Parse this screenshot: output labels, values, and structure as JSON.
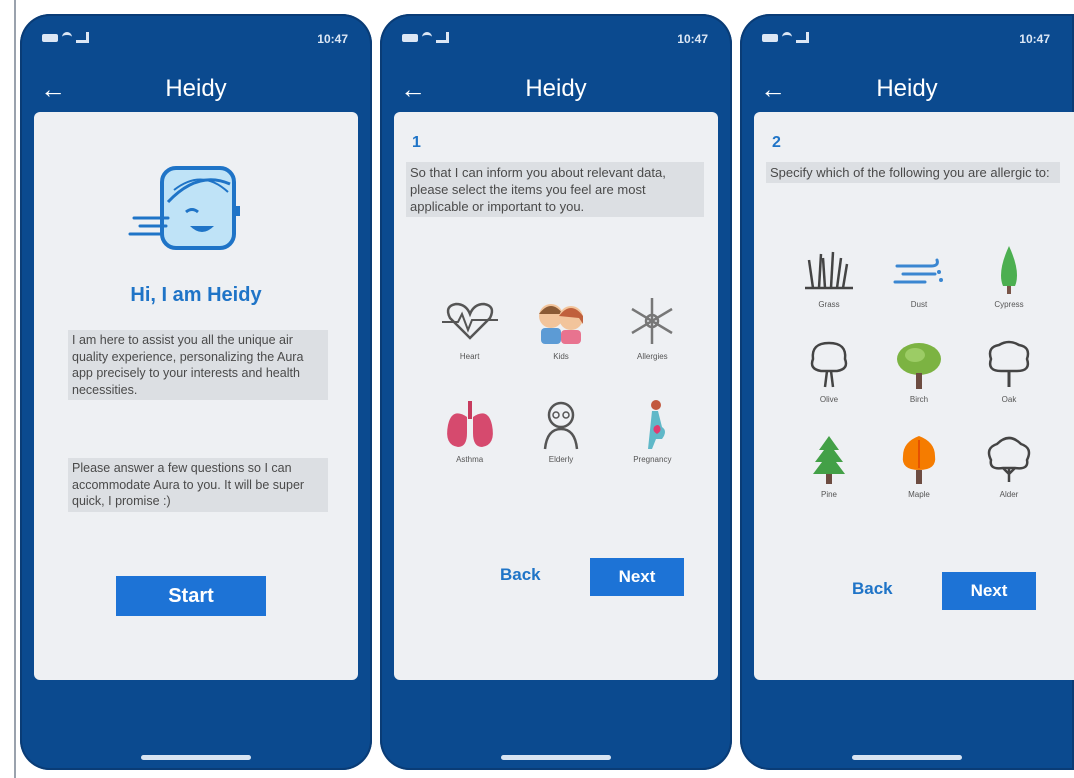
{
  "status": {
    "time": "10:47"
  },
  "screen1": {
    "title": "Heidy",
    "greeting": "Hi, I am Heidy",
    "intro_p1": "I am here to assist you all the unique air quality experience, personalizing the Aura app precisely to your interests and health necessities.",
    "intro_p2": "Please answer a few questions so I can accommodate Aura to you. It will be super quick, I promise :)",
    "start_label": "Start"
  },
  "screen2": {
    "title": "Heidy",
    "step": "1",
    "question": "So that I can inform you about relevant data, please select the items you feel are most applicable or important to you.",
    "options": [
      {
        "label": "Heart",
        "icon": "heart-icon"
      },
      {
        "label": "Kids",
        "icon": "kids-icon"
      },
      {
        "label": "Allergies",
        "icon": "snowflake-icon"
      },
      {
        "label": "Asthma",
        "icon": "lungs-icon"
      },
      {
        "label": "Elderly",
        "icon": "elderly-icon"
      },
      {
        "label": "Pregnancy",
        "icon": "pregnancy-icon"
      }
    ],
    "back_label": "Back",
    "next_label": "Next"
  },
  "screen3": {
    "title": "Heidy",
    "step": "2",
    "question": "Specify which of the following you are allergic to:",
    "options": [
      {
        "label": "Grass",
        "icon": "grass-icon"
      },
      {
        "label": "Dust",
        "icon": "dust-icon"
      },
      {
        "label": "Cypress",
        "icon": "cypress-tree-icon"
      },
      {
        "label": "Olive",
        "icon": "olive-tree-icon"
      },
      {
        "label": "Birch",
        "icon": "birch-tree-icon"
      },
      {
        "label": "Oak",
        "icon": "oak-tree-icon"
      },
      {
        "label": "Pine",
        "icon": "pine-tree-icon"
      },
      {
        "label": "Maple",
        "icon": "maple-tree-icon"
      },
      {
        "label": "Alder",
        "icon": "alder-tree-icon"
      }
    ],
    "back_label": "Back",
    "next_label": "Next"
  },
  "colors": {
    "primary": "#0b4a8f",
    "accent": "#1d73d6",
    "card": "#eef0f3"
  }
}
